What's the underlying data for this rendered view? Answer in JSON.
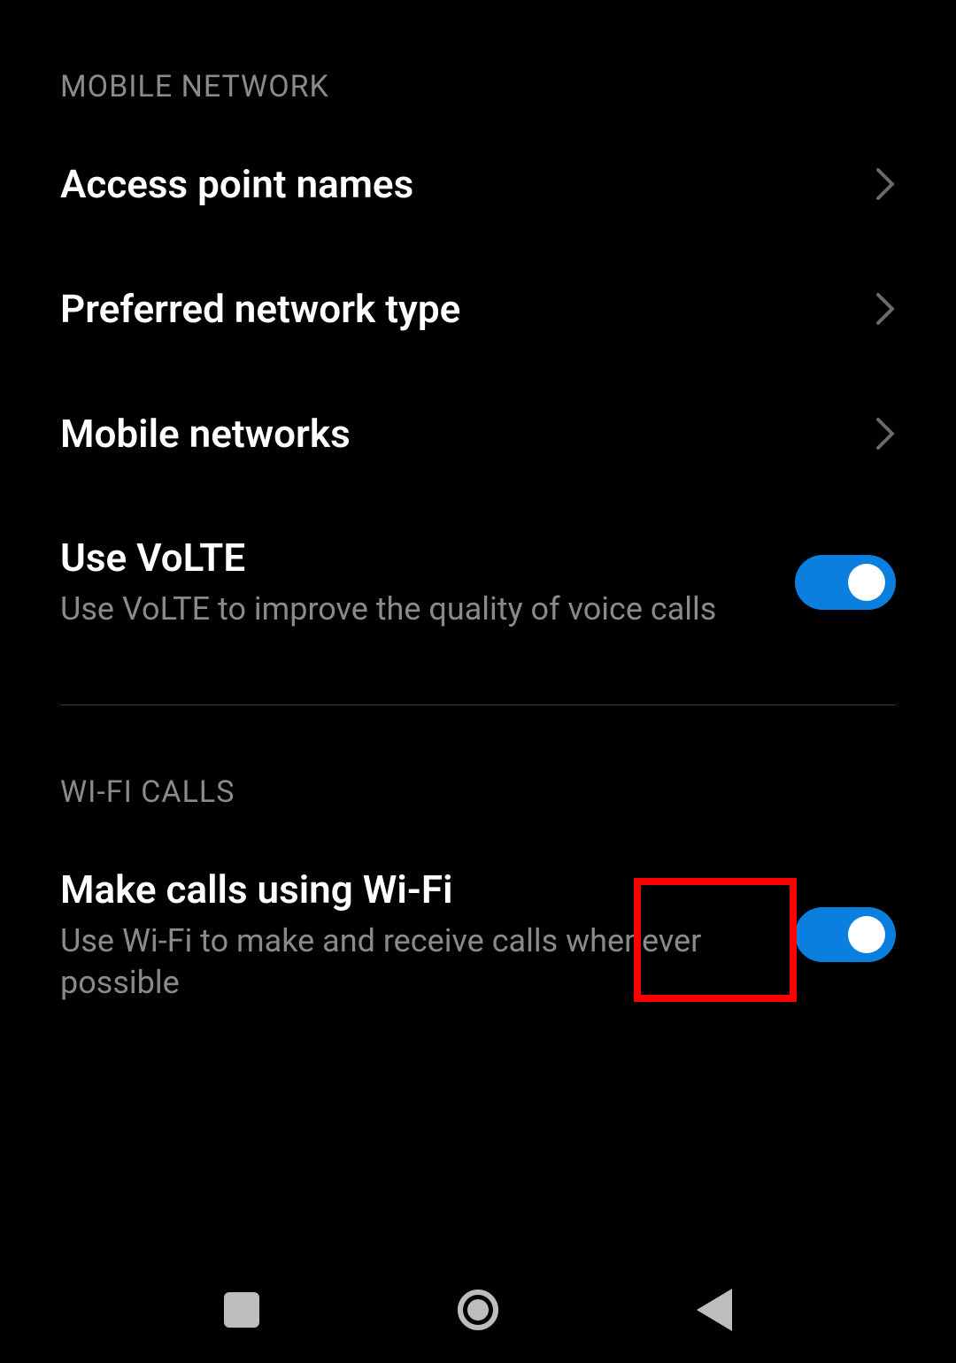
{
  "sections": {
    "mobile_network": {
      "header": "MOBILE NETWORK",
      "items": {
        "apn": {
          "title": "Access point names"
        },
        "preferred": {
          "title": "Preferred network type"
        },
        "mobile": {
          "title": "Mobile networks"
        },
        "volte": {
          "title": "Use VoLTE",
          "subtitle": "Use VoLTE to improve the quality of voice calls",
          "enabled": true
        }
      }
    },
    "wifi_calls": {
      "header": "WI-FI CALLS",
      "items": {
        "wifi_calling": {
          "title": "Make calls using Wi-Fi",
          "subtitle": "Use Wi-Fi to make and receive calls whenever possible",
          "enabled": true
        }
      }
    }
  },
  "highlight": {
    "target": "wifi-calling-toggle"
  }
}
